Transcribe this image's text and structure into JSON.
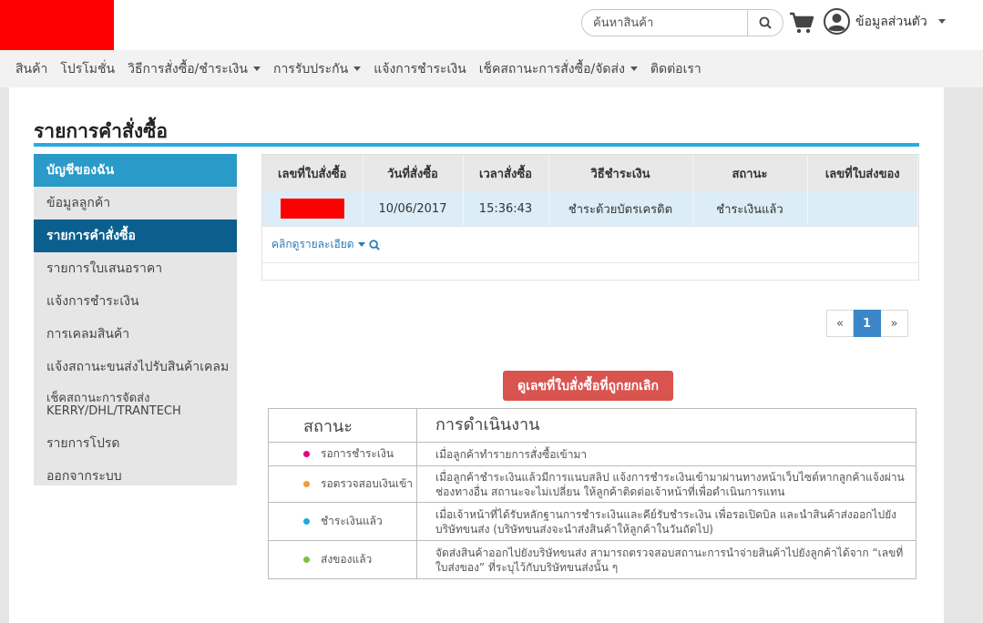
{
  "header": {
    "search_placeholder": "ค้นหาสินค้า",
    "account_label": "ข้อมูลส่วนตัว"
  },
  "nav": [
    {
      "label": "สินค้า",
      "dropdown": false
    },
    {
      "label": "โปรโมชั่น",
      "dropdown": false
    },
    {
      "label": "วิธีการสั่งซื้อ/ชำระเงิน",
      "dropdown": true
    },
    {
      "label": "การรับประกัน",
      "dropdown": true
    },
    {
      "label": "แจ้งการชำระเงิน",
      "dropdown": false
    },
    {
      "label": "เช็คสถานะการสั่งซื้อ/จัดส่ง",
      "dropdown": true
    },
    {
      "label": "ติดต่อเรา",
      "dropdown": false
    }
  ],
  "page": {
    "title": "รายการคำสั่งซื้อ"
  },
  "sidebar": {
    "heading": "บัญชีของฉัน",
    "items": [
      {
        "label": "ข้อมูลลูกค้า"
      },
      {
        "label": "รายการคำสั่งซื้อ",
        "active": true
      },
      {
        "label": "รายการใบเสนอราคา"
      },
      {
        "label": "แจ้งการชำระเงิน"
      },
      {
        "label": "การเคลมสินค้า"
      },
      {
        "label": "แจ้งสถานะขนส่งไปรับสินค้าเคลม"
      },
      {
        "label": "เช็คสถานะการจัดส่ง KERRY/DHL/TRANTECH"
      },
      {
        "label": "รายการโปรด"
      },
      {
        "label": "ออกจากระบบ"
      }
    ]
  },
  "orders": {
    "columns": [
      "เลขที่ใบสั่งซื้อ",
      "วันที่สั่งซื้อ",
      "เวลาสั่งซื้อ",
      "วิธีชำระเงิน",
      "สถานะ",
      "เลขที่ใบส่งของ"
    ],
    "rows": [
      {
        "order_no": "",
        "date": "10/06/2017",
        "time": "15:36:43",
        "payment": "ชำระด้วยบัตรเครดิต",
        "status": "ชำระเงินแล้ว",
        "delivery_no": ""
      }
    ],
    "detail_link": "คลิกดูรายละเอียด"
  },
  "pagination": {
    "prev": "«",
    "current": "1",
    "next": "»"
  },
  "cancel_button": "ดูเลขที่ใบสั่งซื้อที่ถูกยกเลิก",
  "legend": {
    "header_status": "สถานะ",
    "header_action": "การดำเนินงาน",
    "rows": [
      {
        "status": "รอการชำระเงิน",
        "color": "#e6007e",
        "desc": "เมื่อลูกค้าทำรายการสั่งซื้อเข้ามา"
      },
      {
        "status": "รอตรวจสอบเงินเข้า",
        "color": "#f39c33",
        "desc": "เมื่อลูกค้าชำระเงินแล้วมีการแนบสลิป แจ้งการชำระเงินเข้ามาผ่านทางหน้าเว็บไซต์หากลูกค้าแจ้งผ่านช่องทางอื่น สถานะจะไม่เปลี่ยน ให้ลูกค้าติดต่อเจ้าหน้าที่เพื่อดำเนินการแทน"
      },
      {
        "status": "ชำระเงินแล้ว",
        "color": "#1ca9e6",
        "desc": "เมื่อเจ้าหน้าที่ได้รับหลักฐานการชำระเงินและคีย์รับชำระเงิน เพื่อรอเปิดบิล และนำสินค้าส่งออกไปยังบริษัทขนส่ง (บริษัทขนส่งจะนำส่งสินค้าให้ลูกค้าในวันถัดไป)"
      },
      {
        "status": "ส่งของแล้ว",
        "color": "#7bc143",
        "desc": "จัดส่งสินค้าออกไปยังบริษัทขนส่ง สามารถตรวจสอบสถานะการนำจ่ายสินค้าไปยังลูกค้าได้จาก “เลขที่ใบส่งของ” ที่ระบุไว้กับบริษัทขนส่งนั้น ๆ"
      }
    ]
  }
}
